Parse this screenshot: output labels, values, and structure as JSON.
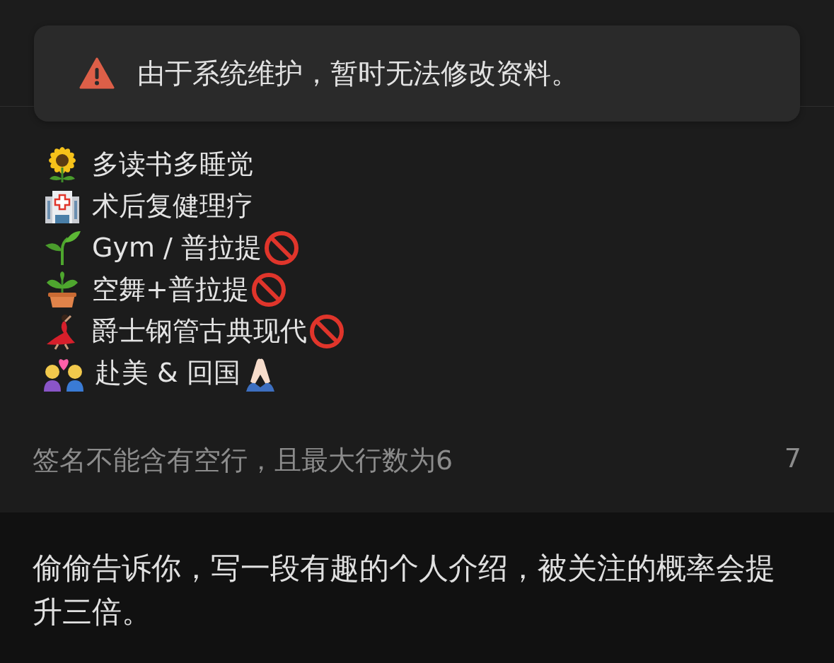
{
  "notice": {
    "kind": "warning",
    "text": "由于系统维护，暂时无法修改资料。"
  },
  "signature": {
    "lines": [
      {
        "kind": "sunflower",
        "text": "多读书多睡觉"
      },
      {
        "kind": "hospital",
        "text": "术后复健理疗"
      },
      {
        "kind": "seedling",
        "text": "Gym / 普拉提",
        "trailing": {
          "kind": "prohibited"
        }
      },
      {
        "kind": "potted-plant",
        "text": "空舞+普拉提",
        "trailing": {
          "kind": "prohibited"
        }
      },
      {
        "kind": "dancer",
        "text": "爵士钢管古典现代",
        "trailing": {
          "kind": "prohibited"
        }
      },
      {
        "kind": "couple",
        "text": "赴美 & 回国",
        "trailing": {
          "kind": "praying-hands"
        }
      }
    ],
    "hint": "签名不能含有空行，且最大行数为6",
    "count": "7"
  },
  "tip": "偷偷告诉你，写一段有趣的个人介绍，被关注的概率会提升三倍。"
}
